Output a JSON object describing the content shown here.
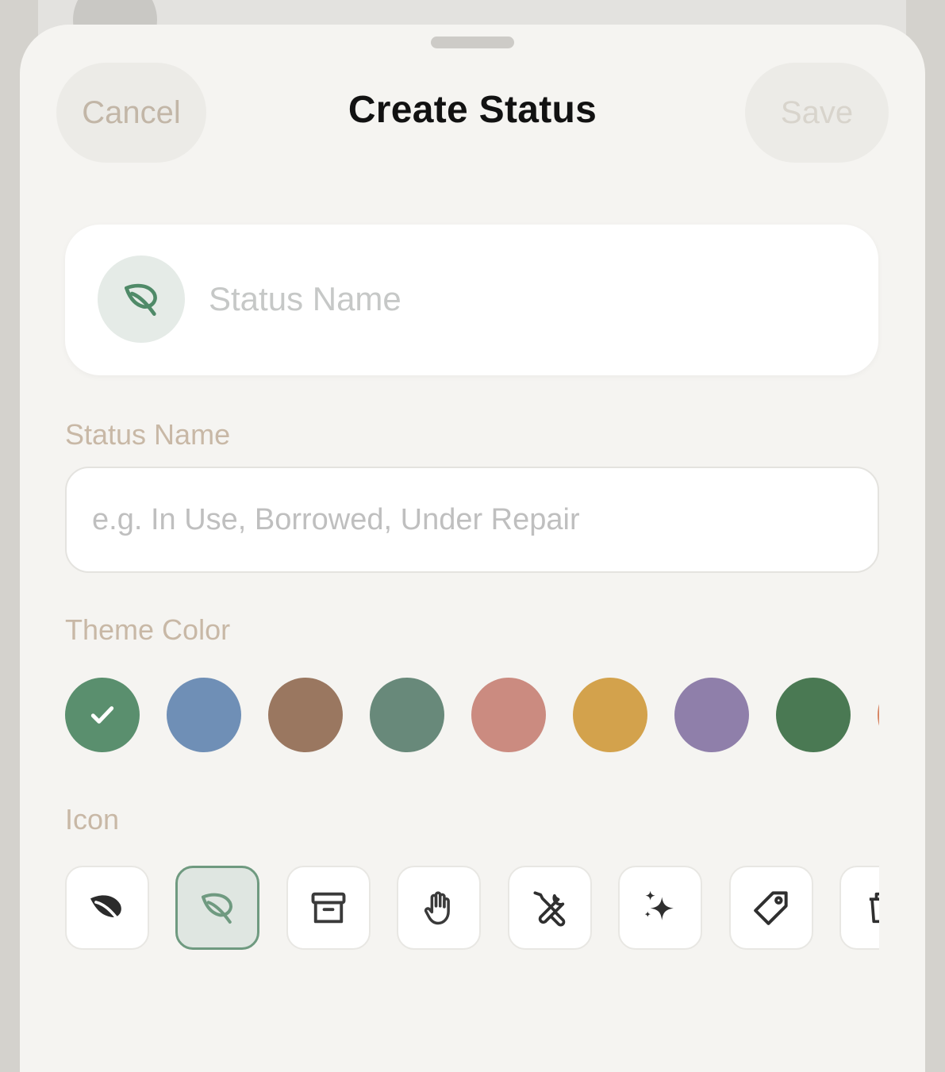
{
  "header": {
    "title": "Create Status",
    "cancel_label": "Cancel",
    "save_label": "Save"
  },
  "preview": {
    "placeholder_name": "Status Name",
    "icon": "leaf-outline-icon"
  },
  "name_field": {
    "label": "Status Name",
    "placeholder": "e.g. In Use, Borrowed, Under Repair",
    "value": ""
  },
  "theme_color": {
    "label": "Theme Color",
    "selected_index": 0,
    "colors": [
      "#5a8f6e",
      "#6f8fb6",
      "#9a7760",
      "#68897a",
      "#cb8b80",
      "#d3a24c",
      "#8f7faa",
      "#4a7953",
      "#d78462"
    ]
  },
  "icon_picker": {
    "label": "Icon",
    "selected_index": 1,
    "icons": [
      "leaf-filled-icon",
      "leaf-outline-icon",
      "archive-box-icon",
      "hand-icon",
      "tools-icon",
      "sparkles-icon",
      "tag-icon",
      "trash-icon"
    ]
  }
}
